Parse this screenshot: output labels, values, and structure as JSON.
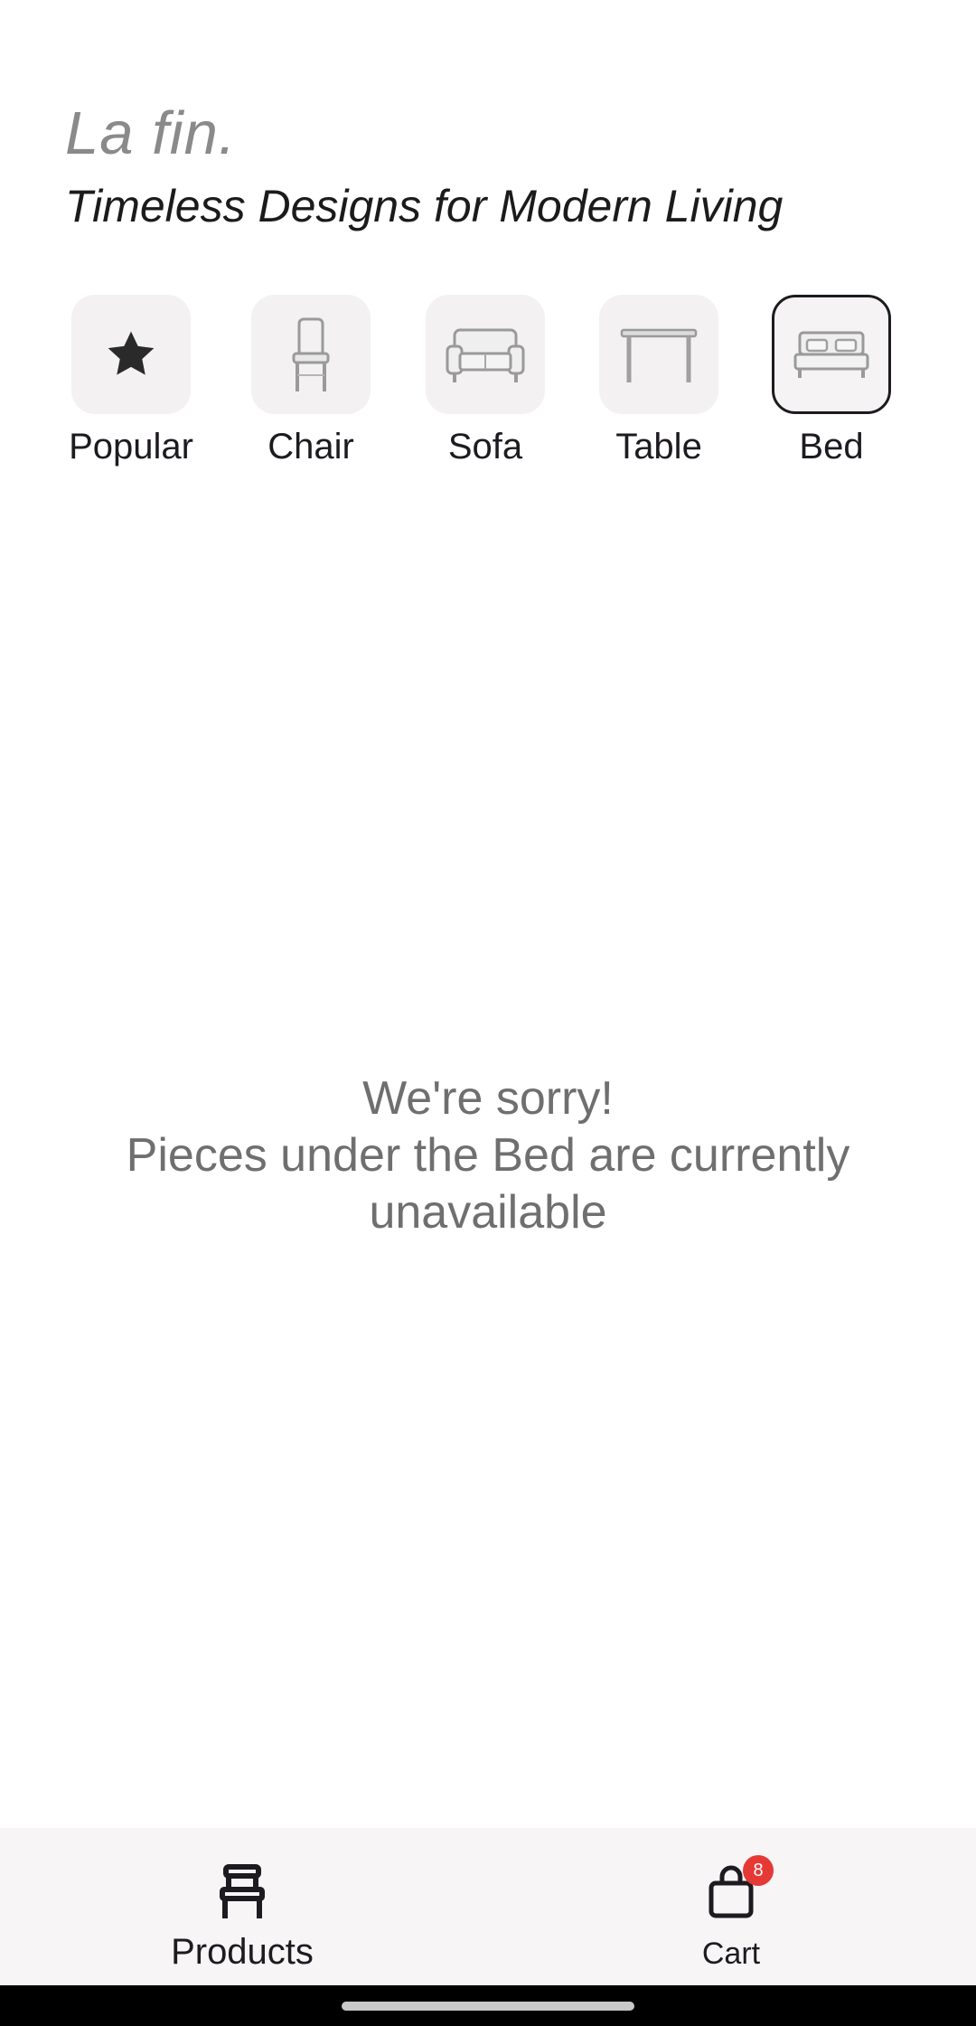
{
  "header": {
    "brand": "La fin.",
    "tagline": "Timeless Designs for Modern Living"
  },
  "categories": [
    {
      "label": "Popular",
      "icon": "star-icon"
    },
    {
      "label": "Chair",
      "icon": "chair-icon"
    },
    {
      "label": "Sofa",
      "icon": "sofa-icon"
    },
    {
      "label": "Table",
      "icon": "table-icon"
    },
    {
      "label": "Bed",
      "icon": "bed-icon",
      "selected": true
    }
  ],
  "empty_state": {
    "line1": "We're sorry!",
    "line2": "Pieces under the Bed are currently",
    "line3": "unavailable"
  },
  "bottom_nav": {
    "products_label": "Products",
    "products_icon": "chair-icon",
    "cart_label": "Cart",
    "cart_icon": "shopping-bag-icon",
    "cart_badge": "8"
  },
  "colors": {
    "accent": "#1d1b20",
    "badge": "#e53935",
    "muted_text": "#6f6f6f"
  }
}
